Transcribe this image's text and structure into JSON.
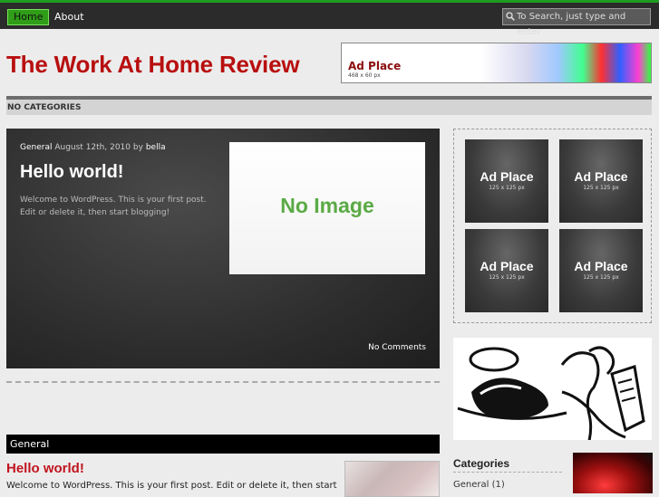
{
  "nav": {
    "home": "Home",
    "about": "About"
  },
  "search": {
    "placeholder": "To Search, just type and enter"
  },
  "site": {
    "title": "The Work At Home Review"
  },
  "banner": {
    "title": "Ad Place",
    "size": "468 x 60 px"
  },
  "category_bar": {
    "label": "NO CATEGORIES"
  },
  "featured": {
    "category": "General",
    "date": "August 12th, 2010",
    "by": "by",
    "author": "bella",
    "title": "Hello world!",
    "excerpt": "Welcome to WordPress. This is your first post. Edit or delete it, then start blogging!",
    "image_text": "No Image",
    "comments": "No Comments"
  },
  "section": {
    "title": "General"
  },
  "post2": {
    "title": "Hello world!",
    "text": "Welcome to WordPress. This is your first post. Edit or delete it, then start"
  },
  "ads": [
    {
      "title": "Ad Place",
      "size": "125 x 125 px"
    },
    {
      "title": "Ad Place",
      "size": "125 x 125 px"
    },
    {
      "title": "Ad Place",
      "size": "125 x 125 px"
    },
    {
      "title": "Ad Place",
      "size": "125 x 125 px"
    }
  ],
  "sidebar": {
    "categories_title": "Categories",
    "categories": [
      {
        "label": "General (1)"
      }
    ]
  },
  "colors": {
    "accent": "#1f9b1f",
    "title_red": "#b80f0f",
    "nav_bg": "#2b2b2b"
  }
}
